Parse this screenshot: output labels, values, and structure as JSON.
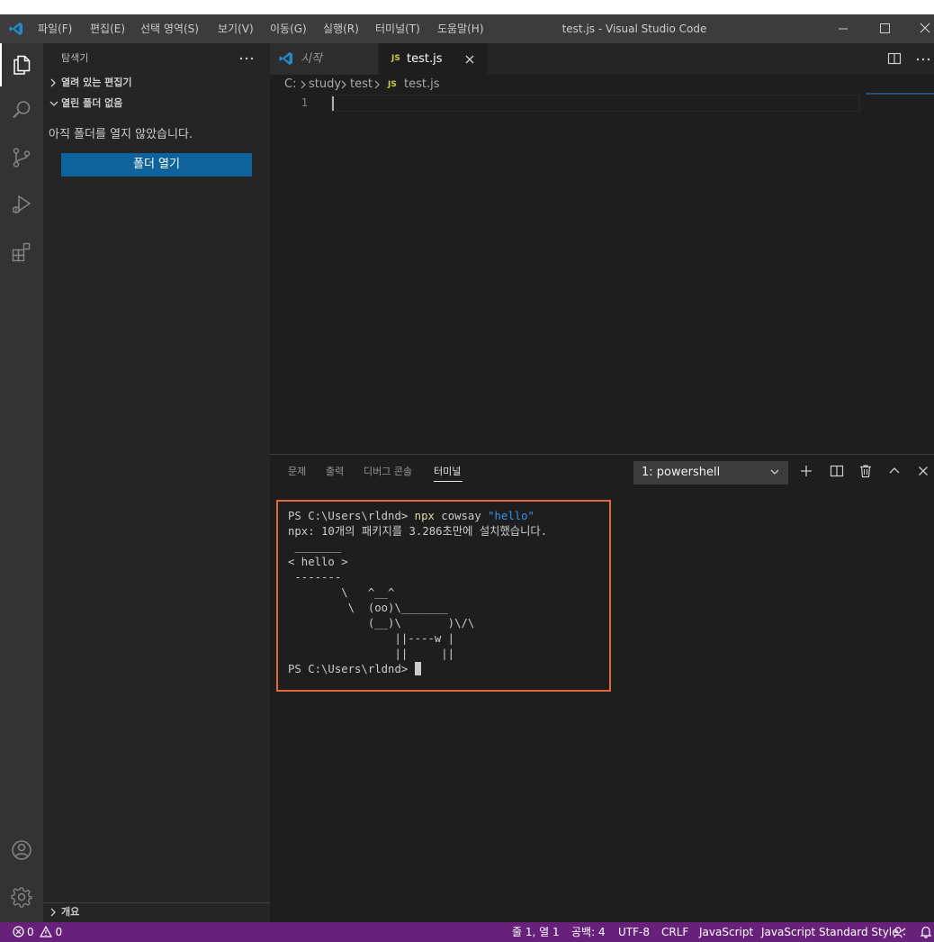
{
  "titlebar": {
    "menus": [
      "파일(F)",
      "편집(E)",
      "선택 영역(S)",
      "보기(V)",
      "이동(G)",
      "실행(R)",
      "터미널(T)",
      "도움말(H)"
    ],
    "window_title": "test.js - Visual Studio Code"
  },
  "sidebar": {
    "title": "탐색기",
    "open_editors_label": "열려 있는 편집기",
    "no_folder_label": "열린 폴더 없음",
    "no_folder_message": "아직 폴더를 열지 않았습니다.",
    "open_folder_button": "폴더 열기",
    "outline_label": "개요"
  },
  "editor": {
    "tabs": [
      {
        "label": "시작",
        "active": false
      },
      {
        "label": "test.js",
        "active": true
      }
    ],
    "js_badge": "JS",
    "breadcrumb": [
      "C:",
      "study",
      "test",
      "test.js"
    ],
    "line_numbers": [
      "1"
    ]
  },
  "panel": {
    "tabs": [
      "문제",
      "출력",
      "디버그 콘솔",
      "터미널"
    ],
    "active_tab": "터미널",
    "terminal_select": "1: powershell",
    "terminal": {
      "prompt": "PS C:\\Users\\rldnd>",
      "command": "npx",
      "arg_word": "cowsay",
      "arg_string": "\"hello\"",
      "install_msg": "npx: 10개의 패키지를 3.286초만에 설치했습니다.",
      "cow_top": " _______",
      "cow_msg": "< hello >",
      "cow_bottom": " -------",
      "cow_l1": "        \\   ^__^",
      "cow_l2": "         \\  (oo)\\_______",
      "cow_l3": "            (__)\\       )\\/\\",
      "cow_l4": "                ||----w |",
      "cow_l5": "                ||     ||"
    }
  },
  "statusbar": {
    "errors": "0",
    "warnings": "0",
    "position": "줄 1, 열 1",
    "spaces": "공백: 4",
    "encoding": "UTF-8",
    "eol": "CRLF",
    "language": "JavaScript",
    "linter": "JavaScript Standard Style"
  },
  "colors": {
    "statusbar_bg": "#68217a",
    "accent_blue": "#0e639c",
    "highlight_box": "#e2673c",
    "js_badge": "#cbcb41"
  }
}
